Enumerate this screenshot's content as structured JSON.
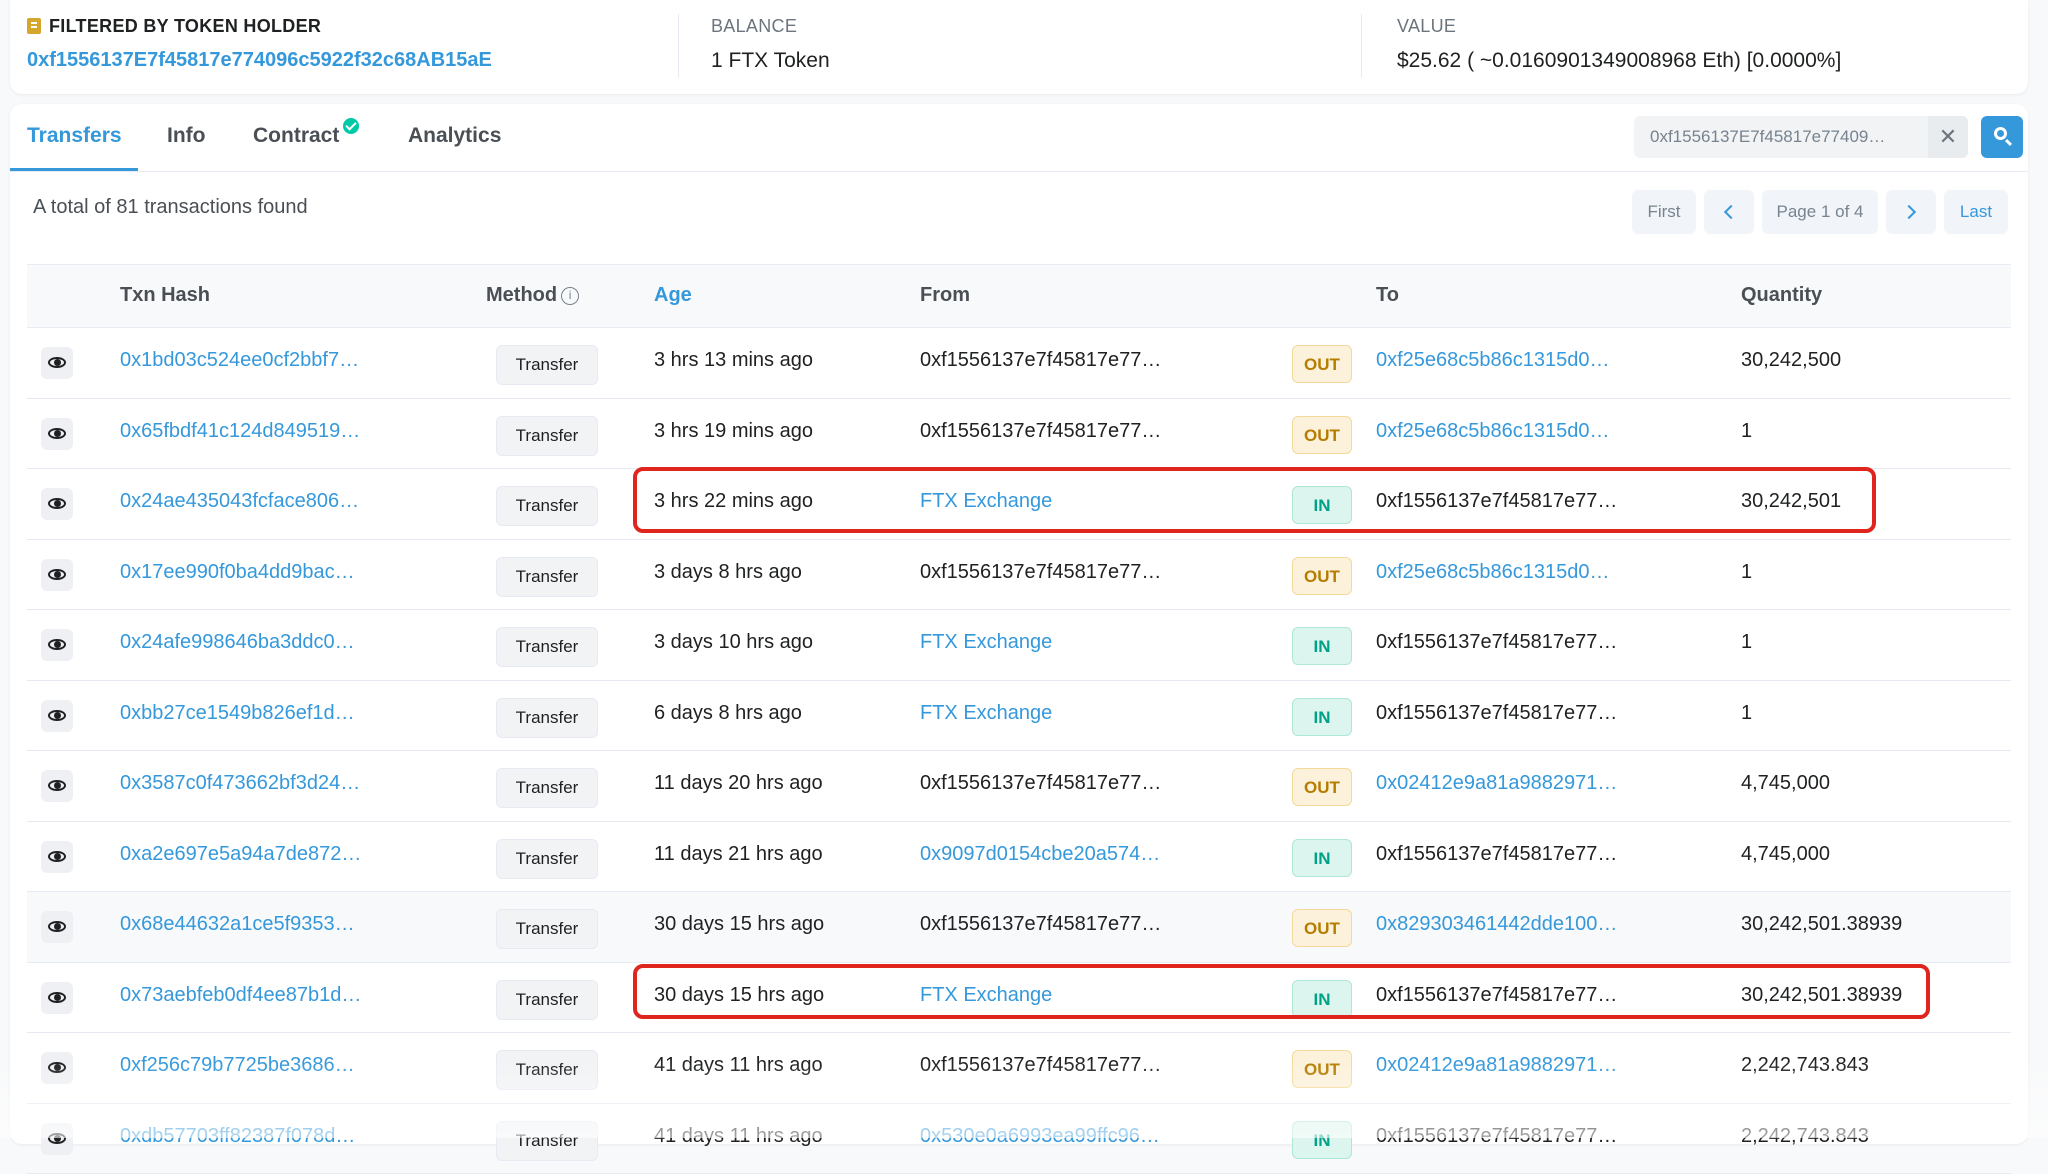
{
  "summary": {
    "holder_label": "FILTERED BY TOKEN HOLDER",
    "holder_address": "0xf1556137E7f45817e774096c5922f32c68AB15aE",
    "balance_label": "BALANCE",
    "balance_value": "1 FTX Token",
    "value_label": "VALUE",
    "value_value": "$25.62 ( ~0.0160901349008968 Eth) [0.0000%]"
  },
  "tabs": [
    "Transfers",
    "Info",
    "Contract",
    "Analytics"
  ],
  "search": {
    "value": "0xf1556137E7f45817e77409…",
    "clear": "✕"
  },
  "total_text": "A total of 81 transactions found",
  "pager": {
    "first": "First",
    "page": "Page 1 of 4",
    "last": "Last"
  },
  "columns": {
    "txn_hash": "Txn Hash",
    "method": "Method",
    "method_info": "i",
    "age": "Age",
    "from": "From",
    "to": "To",
    "quantity": "Quantity"
  },
  "colors": {
    "accent": "#3498db",
    "out_badge": "#b47d00",
    "in_badge": "#00a186",
    "highlight": "#e0251f"
  },
  "rows": [
    {
      "hash": "0x1bd03c524ee0cf2bbf7…",
      "method": "Transfer",
      "age": "3 hrs 13 mins ago",
      "from": "0xf1556137e7f45817e77…",
      "from_link": false,
      "dir": "OUT",
      "to": "0xf25e68c5b86c1315d0…",
      "to_link": true,
      "qty": "30,242,500"
    },
    {
      "hash": "0x65fbdf41c124d849519…",
      "method": "Transfer",
      "age": "3 hrs 19 mins ago",
      "from": "0xf1556137e7f45817e77…",
      "from_link": false,
      "dir": "OUT",
      "to": "0xf25e68c5b86c1315d0…",
      "to_link": true,
      "qty": "1"
    },
    {
      "hash": "0x24ae435043fcface806…",
      "method": "Transfer",
      "age": "3 hrs 22 mins ago",
      "from": "FTX Exchange",
      "from_link": true,
      "dir": "IN",
      "to": "0xf1556137e7f45817e77…",
      "to_link": false,
      "qty": "30,242,501"
    },
    {
      "hash": "0x17ee990f0ba4dd9bac…",
      "method": "Transfer",
      "age": "3 days 8 hrs ago",
      "from": "0xf1556137e7f45817e77…",
      "from_link": false,
      "dir": "OUT",
      "to": "0xf25e68c5b86c1315d0…",
      "to_link": true,
      "qty": "1"
    },
    {
      "hash": "0x24afe998646ba3ddc0…",
      "method": "Transfer",
      "age": "3 days 10 hrs ago",
      "from": "FTX Exchange",
      "from_link": true,
      "dir": "IN",
      "to": "0xf1556137e7f45817e77…",
      "to_link": false,
      "qty": "1"
    },
    {
      "hash": "0xbb27ce1549b826ef1d…",
      "method": "Transfer",
      "age": "6 days 8 hrs ago",
      "from": "FTX Exchange",
      "from_link": true,
      "dir": "IN",
      "to": "0xf1556137e7f45817e77…",
      "to_link": false,
      "qty": "1"
    },
    {
      "hash": "0x3587c0f473662bf3d24…",
      "method": "Transfer",
      "age": "11 days 20 hrs ago",
      "from": "0xf1556137e7f45817e77…",
      "from_link": false,
      "dir": "OUT",
      "to": "0x02412e9a81a9882971…",
      "to_link": true,
      "qty": "4,745,000"
    },
    {
      "hash": "0xa2e697e5a94a7de872…",
      "method": "Transfer",
      "age": "11 days 21 hrs ago",
      "from": "0x9097d0154cbe20a574…",
      "from_link": true,
      "dir": "IN",
      "to": "0xf1556137e7f45817e77…",
      "to_link": false,
      "qty": "4,745,000"
    },
    {
      "hash": "0x68e44632a1ce5f9353…",
      "method": "Transfer",
      "age": "30 days 15 hrs ago",
      "from": "0xf1556137e7f45817e77…",
      "from_link": false,
      "dir": "OUT",
      "to": "0x829303461442dde100…",
      "to_link": true,
      "qty": "30,242,501.38939"
    },
    {
      "hash": "0x73aebfeb0df4ee87b1d…",
      "method": "Transfer",
      "age": "30 days 15 hrs ago",
      "from": "FTX Exchange",
      "from_link": true,
      "dir": "IN",
      "to": "0xf1556137e7f45817e77…",
      "to_link": false,
      "qty": "30,242,501.38939"
    },
    {
      "hash": "0xf256c79b7725be3686…",
      "method": "Transfer",
      "age": "41 days 11 hrs ago",
      "from": "0xf1556137e7f45817e77…",
      "from_link": false,
      "dir": "OUT",
      "to": "0x02412e9a81a9882971…",
      "to_link": true,
      "qty": "2,242,743.843"
    },
    {
      "hash": "0xdb57703ff82387f078d…",
      "method": "Transfer",
      "age": "41 days 11 hrs ago",
      "from": "0x530e0a6993ea99ffc96…",
      "from_link": true,
      "dir": "IN",
      "to": "0xf1556137e7f45817e77…",
      "to_link": false,
      "qty": "2,242,743.843"
    }
  ]
}
